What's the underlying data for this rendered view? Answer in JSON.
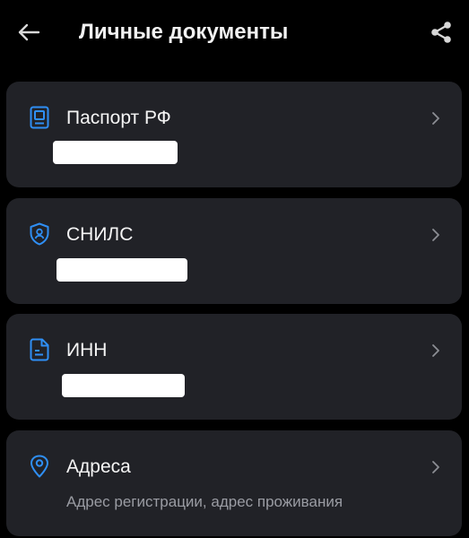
{
  "header": {
    "back_icon": "arrow-left-icon",
    "title": "Личные документы",
    "share_icon": "share-icon"
  },
  "accent_color": "#2f8ff5",
  "documents": [
    {
      "label": "Паспорт РФ",
      "icon": "passport-icon",
      "value_redacted": true
    },
    {
      "label": "СНИЛС",
      "icon": "shield-person-icon",
      "value_redacted": true
    },
    {
      "label": "ИНН",
      "icon": "document-icon",
      "value_redacted": true
    },
    {
      "label": "Адреса",
      "icon": "location-pin-icon",
      "subtitle": "Адрес регистрации, адрес проживания"
    }
  ]
}
